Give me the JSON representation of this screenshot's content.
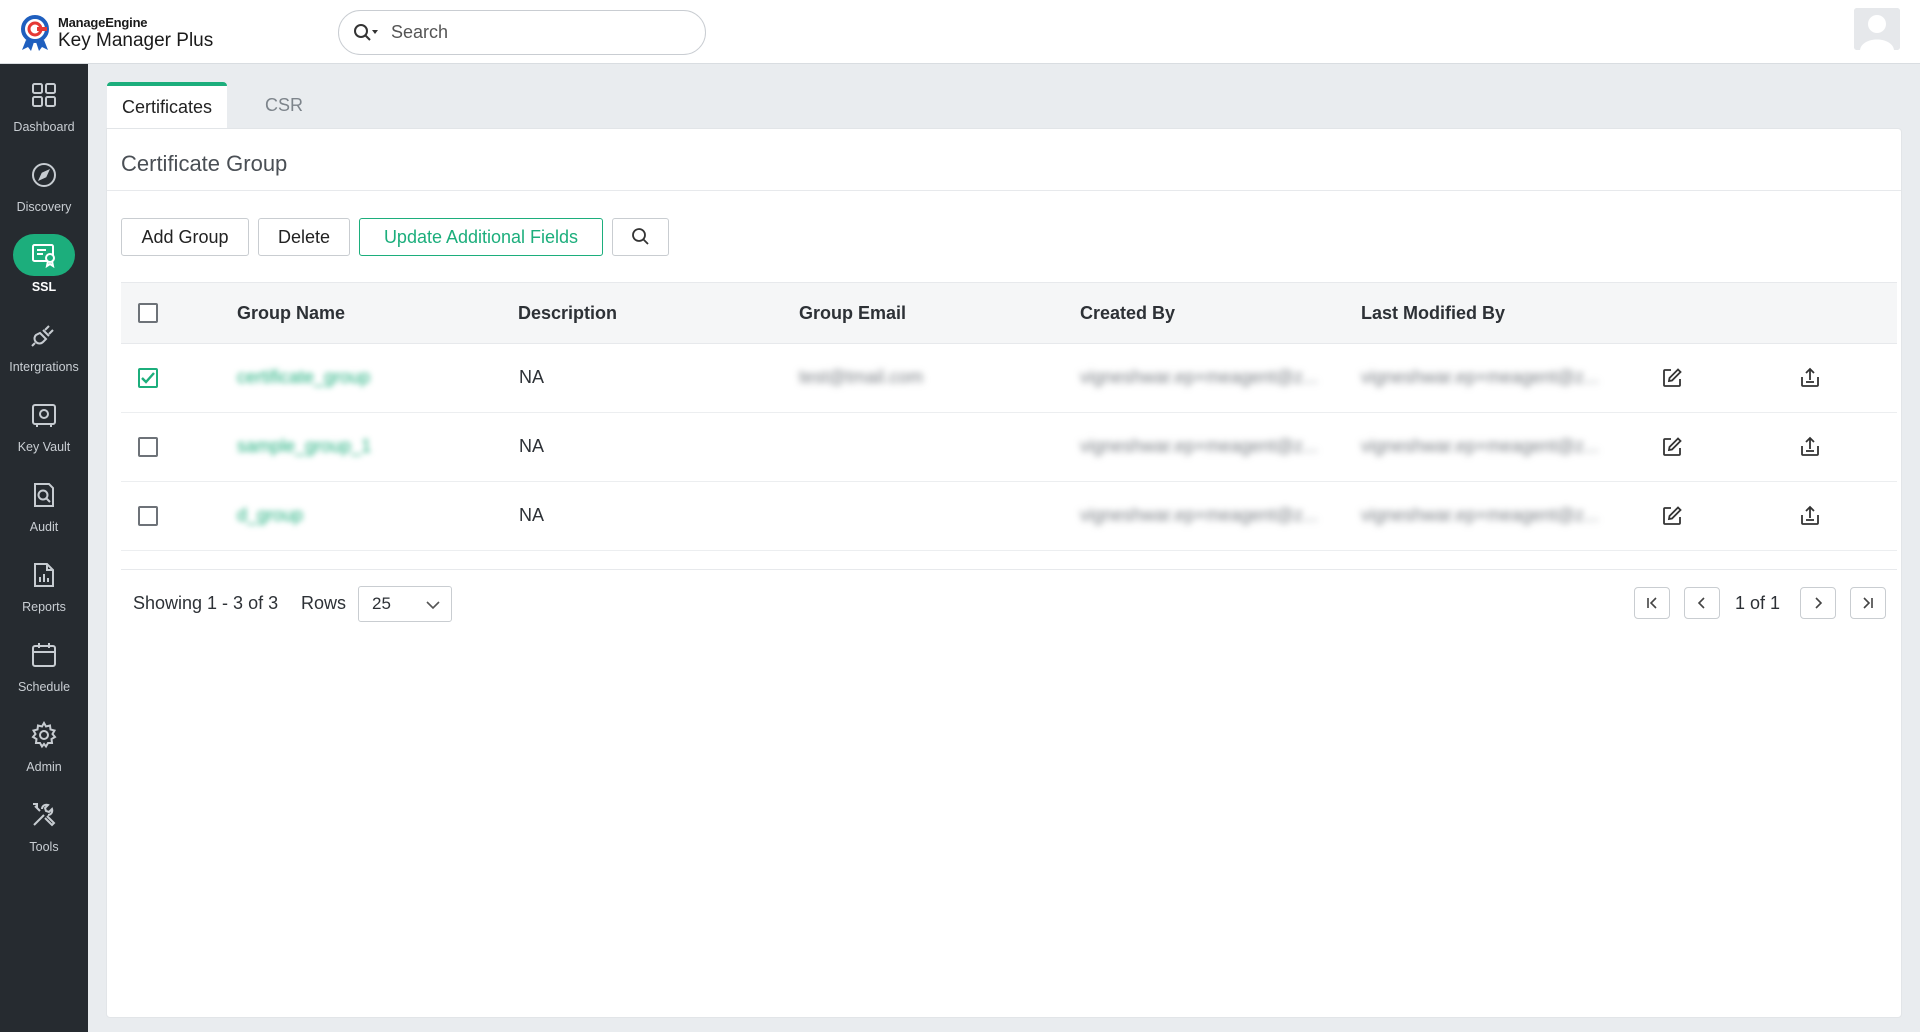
{
  "app": {
    "vendor": "ManageEngine",
    "product": "Key Manager Plus"
  },
  "search": {
    "placeholder": "Search"
  },
  "sidebar": {
    "items": [
      {
        "label": "Dashboard",
        "icon": "dashboard-icon"
      },
      {
        "label": "Discovery",
        "icon": "compass-icon"
      },
      {
        "label": "SSL",
        "icon": "certificate-icon",
        "active": true
      },
      {
        "label": "Intergrations",
        "icon": "plug-icon"
      },
      {
        "label": "Key Vault",
        "icon": "vault-icon"
      },
      {
        "label": "Audit",
        "icon": "audit-icon"
      },
      {
        "label": "Reports",
        "icon": "report-icon"
      },
      {
        "label": "Schedule",
        "icon": "calendar-icon"
      },
      {
        "label": "Admin",
        "icon": "gear-icon"
      },
      {
        "label": "Tools",
        "icon": "tools-icon"
      }
    ]
  },
  "tabs": [
    {
      "label": "Certificates",
      "active": true
    },
    {
      "label": "CSR",
      "active": false
    }
  ],
  "panel": {
    "title": "Certificate Group"
  },
  "toolbar": {
    "add_group": "Add Group",
    "delete": "Delete",
    "update_fields": "Update Additional Fields"
  },
  "table": {
    "columns": [
      "Group Name",
      "Description",
      "Group Email",
      "Created By",
      "Last Modified By"
    ],
    "rows": [
      {
        "name": "certificate_group",
        "description": "NA",
        "email": "test@tmail.com",
        "created_by": "vigneshwar.ep+meagent@z...",
        "modified_by": "vigneshwar.ep+meagent@z...",
        "checked": true
      },
      {
        "name": "sample_group_1",
        "description": "NA",
        "email": "",
        "created_by": "vigneshwar.ep+meagent@z...",
        "modified_by": "vigneshwar.ep+meagent@z...",
        "checked": false
      },
      {
        "name": "d_group",
        "description": "NA",
        "email": "",
        "created_by": "vigneshwar.ep+meagent@z...",
        "modified_by": "vigneshwar.ep+meagent@z...",
        "checked": false
      }
    ]
  },
  "footer": {
    "showing": "Showing 1 - 3 of 3",
    "rows_label": "Rows",
    "rows_value": "25",
    "page_info": "1 of 1"
  },
  "colors": {
    "accent": "#1cae7c",
    "sidebar_bg": "#262b30",
    "page_bg": "#e9ecef"
  }
}
